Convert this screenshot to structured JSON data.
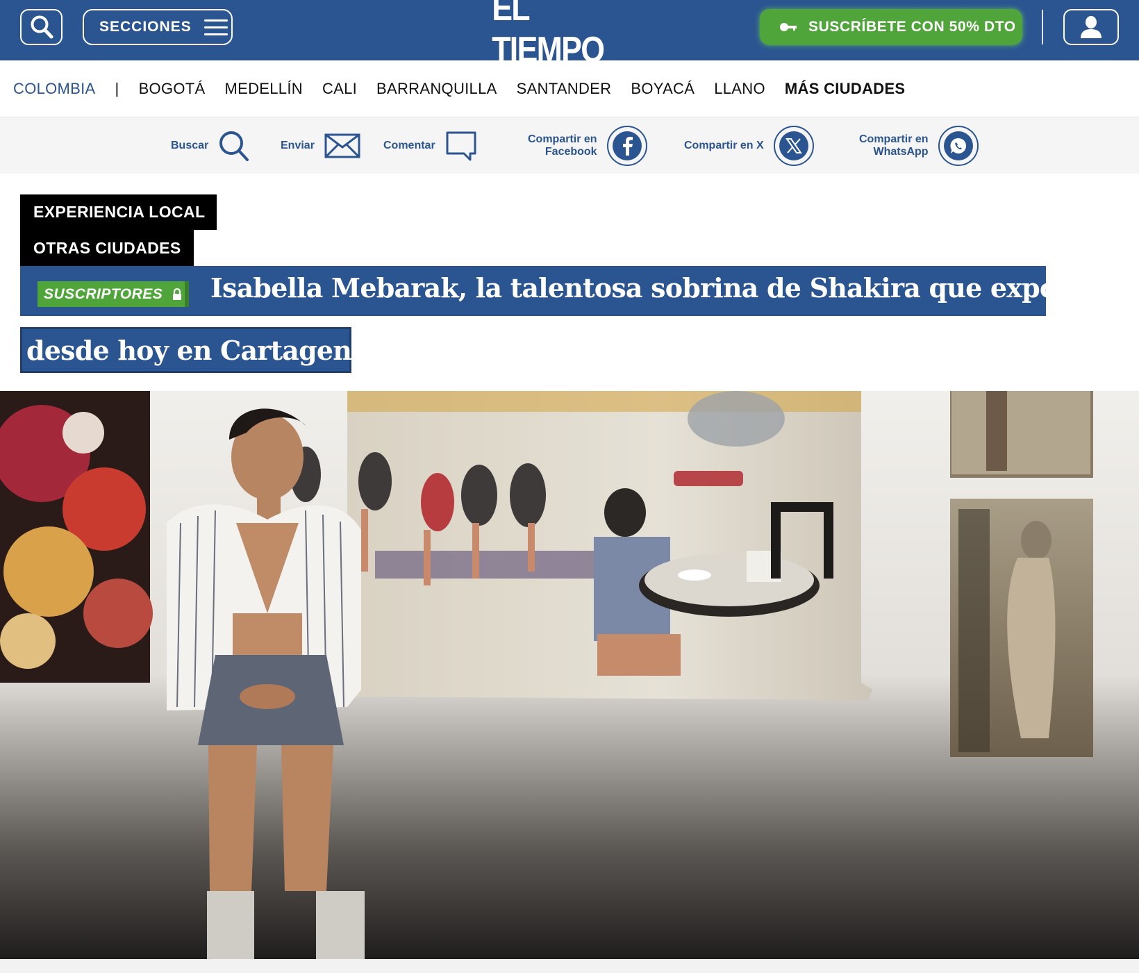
{
  "header": {
    "logo": "EL TIEMPO",
    "sections_label": "SECCIONES",
    "subscribe_label": "SUSCRÍBETE CON 50% DTO",
    "colors": {
      "brand_blue": "#2b5591",
      "subscribe_green": "#4fa53a"
    }
  },
  "citynav": {
    "items": [
      "COLOMBIA",
      "BOGOTÁ",
      "MEDELLÍN",
      "CALI",
      "BARRANQUILLA",
      "SANTANDER",
      "BOYACÁ",
      "LLANO",
      "MÁS CIUDADES"
    ],
    "separator": "|"
  },
  "sharebar": {
    "search": "Buscar",
    "send": "Enviar",
    "comment": "Comentar",
    "facebook_line1": "Compartir en",
    "facebook_line2": "Facebook",
    "x": "Compartir en X",
    "whatsapp_line1": "Compartir en",
    "whatsapp_line2": "WhatsApp"
  },
  "article": {
    "tags": [
      "EXPERIENCIA LOCAL",
      "OTRAS CIUDADES"
    ],
    "badge": "SUSCRIPTORES",
    "headline_line1": "Isabella Mebarak, la talentosa sobrina de Shakira que expone",
    "headline_line2": "desde hoy en Cartagena"
  },
  "icons": [
    "search-icon",
    "hamburger-icon",
    "key-icon",
    "user-icon",
    "envelope-icon",
    "comment-icon",
    "facebook-icon",
    "x-icon",
    "whatsapp-icon",
    "lock-icon"
  ]
}
